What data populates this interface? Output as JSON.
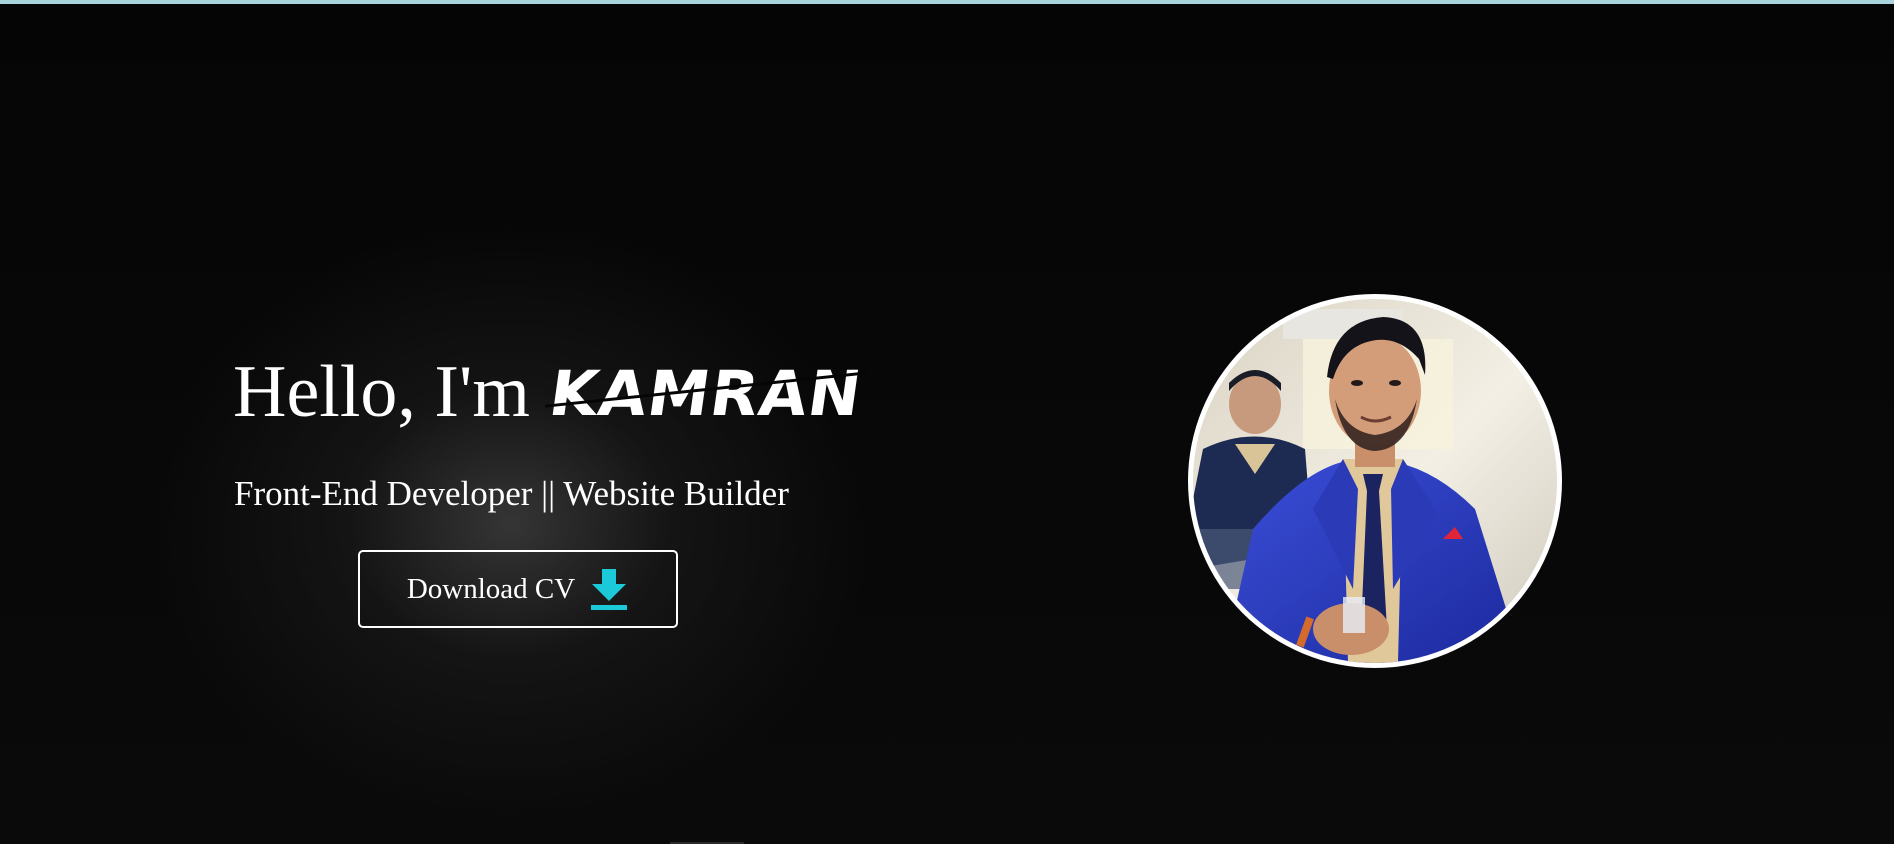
{
  "hero": {
    "greeting": "Hello, I'm",
    "name": "KAMRAN",
    "subtitle": "Front-End Developer || Website Builder",
    "cta": {
      "label": "Download CV",
      "icon": "download-icon"
    },
    "portrait": {
      "alt": "Profile photo of Kamran"
    }
  },
  "colors": {
    "background": "#000000",
    "text": "#ffffff",
    "accent": "#1cc9d8",
    "top_strip": "#a9d6dc"
  }
}
